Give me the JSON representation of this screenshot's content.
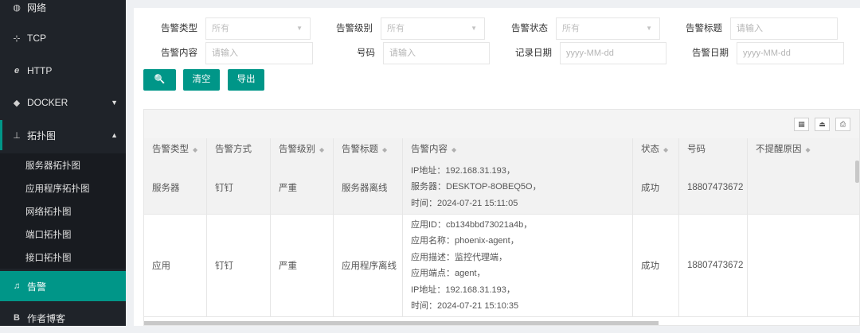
{
  "sidebar": {
    "items": [
      {
        "label": "网络",
        "icon": "globe-icon",
        "glyph": "◍"
      },
      {
        "label": "TCP",
        "icon": "network-icon",
        "glyph": "⊹"
      },
      {
        "label": "HTTP",
        "icon": "http-icon",
        "glyph": "e"
      },
      {
        "label": "DOCKER",
        "icon": "docker-icon",
        "glyph": "◆"
      },
      {
        "label": "拓扑图",
        "icon": "sitemap-icon",
        "glyph": "⊥"
      }
    ],
    "submenu": [
      "服务器拓扑图",
      "应用程序拓扑图",
      "网络拓扑图",
      "端口拓扑图",
      "接口拓扑图"
    ],
    "active": {
      "label": "告警",
      "icon": "bell-icon",
      "glyph": "♫"
    },
    "last": {
      "label": "作者博客",
      "icon": "blog-icon",
      "glyph": "B"
    },
    "caret_down": "▼",
    "caret_up": "▲"
  },
  "filters": {
    "alert_type": {
      "label": "告警类型",
      "value": "所有"
    },
    "alert_level": {
      "label": "告警级别",
      "value": "所有"
    },
    "alert_status": {
      "label": "告警状态",
      "value": "所有"
    },
    "alert_title": {
      "label": "告警标题",
      "placeholder": "请输入"
    },
    "alert_content": {
      "label": "告警内容",
      "placeholder": "请输入"
    },
    "number": {
      "label": "号码",
      "placeholder": "请输入"
    },
    "record_date": {
      "label": "记录日期",
      "placeholder": "yyyy-MM-dd"
    },
    "alert_date": {
      "label": "告警日期",
      "placeholder": "yyyy-MM-dd"
    },
    "dropdown_glyph": "▼"
  },
  "buttons": {
    "search_glyph": "🔍",
    "clear": "清空",
    "export": "导出"
  },
  "toolbar": {
    "columns_glyph": "▦",
    "export_glyph": "⏏",
    "print_glyph": "⎙"
  },
  "table": {
    "sort_glyph": "◆",
    "columns": [
      "告警类型",
      "告警方式",
      "告警级别",
      "告警标题",
      "告警内容",
      "状态",
      "号码",
      "不提醒原因"
    ],
    "rows": [
      {
        "type": "服务器",
        "method": "钉钉",
        "level": "严重",
        "title": "服务器离线",
        "content": [
          "IP地址：192.168.31.193，",
          "服务器：DESKTOP-8OBEQ5O，",
          "时间：2024-07-21 15:11:05"
        ],
        "status": "成功",
        "number": "18807473672",
        "reason": ""
      },
      {
        "type": "应用",
        "method": "钉钉",
        "level": "严重",
        "title": "应用程序离线",
        "content": [
          "应用ID：cb134bbd73021a4b，",
          "应用名称：phoenix-agent，",
          "应用描述：监控代理端，",
          "应用端点：agent，",
          "IP地址：192.168.31.193，",
          "时间：2024-07-21 15:10:35"
        ],
        "status": "成功",
        "number": "18807473672",
        "reason": ""
      }
    ]
  }
}
